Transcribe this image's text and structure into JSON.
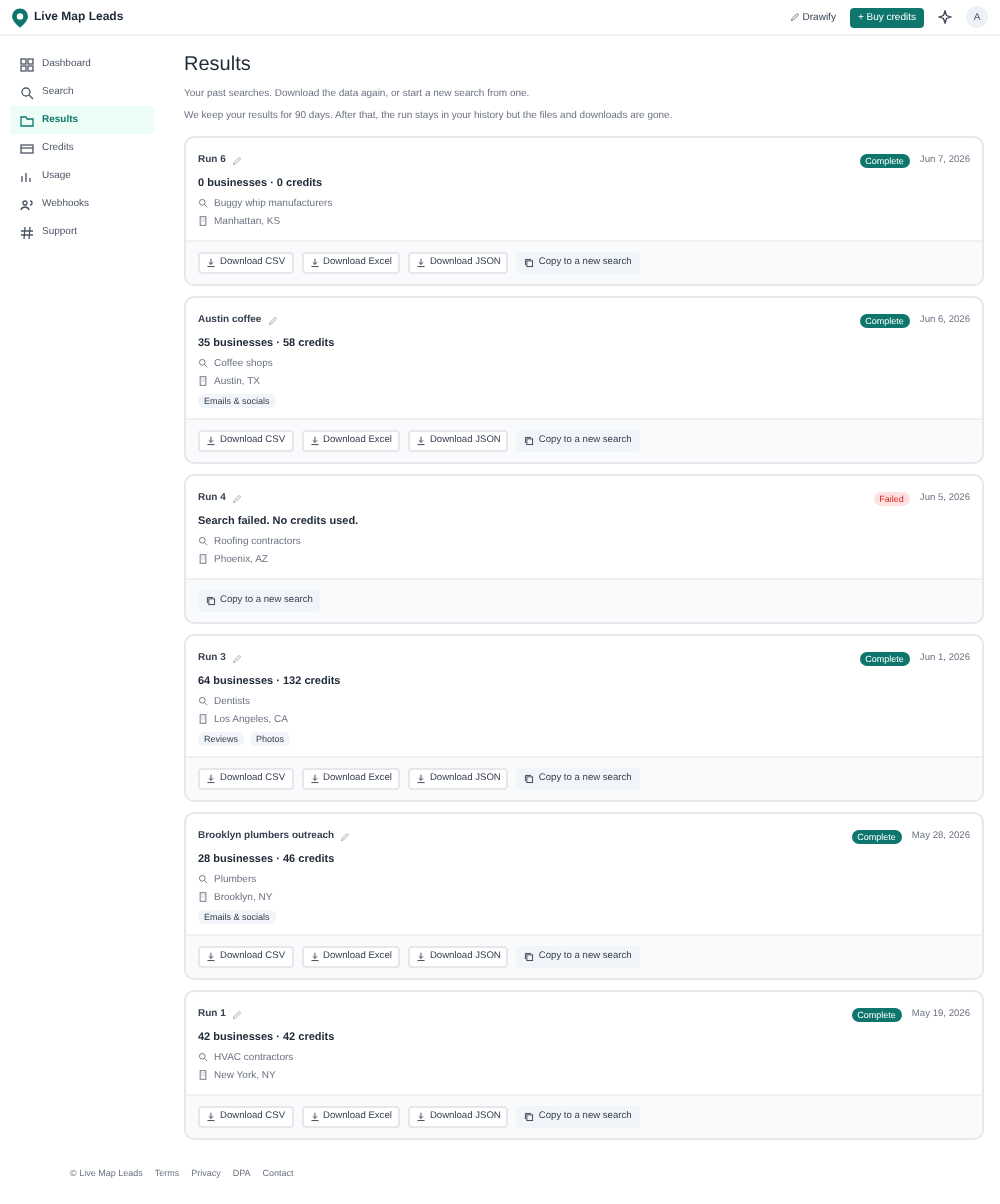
{
  "header": {
    "brand": "Live Map Leads",
    "link": "Drawify",
    "buy_button": "+ Buy credits",
    "avatar": "A"
  },
  "sidebar": {
    "items": [
      {
        "label": "Dashboard",
        "selected": false
      },
      {
        "label": "Search",
        "selected": false
      },
      {
        "label": "Results",
        "selected": true
      },
      {
        "label": "Credits",
        "selected": false
      },
      {
        "label": "Usage",
        "selected": false
      },
      {
        "label": "Webhooks",
        "selected": false
      },
      {
        "label": "Support",
        "selected": false
      }
    ]
  },
  "page": {
    "title": "Results",
    "subtitle": "Your past searches. Download the data again, or start a new search from one.",
    "note": "We keep your results for 90 days. After that, the run stays in your history but the files and downloads are gone."
  },
  "runs": [
    {
      "name": "Run 6",
      "kind": "complete",
      "status_label": "Complete",
      "date": "Jun 7, 2026",
      "summary": "0 businesses · 0 credits",
      "query": "Buggy whip manufacturers",
      "location": "Manhattan, KS",
      "actions": [
        {
          "kind": "download",
          "label": "Download CSV"
        },
        {
          "kind": "download",
          "label": "Download Excel"
        },
        {
          "kind": "download",
          "label": "Download JSON"
        },
        {
          "kind": "copy",
          "label": "Copy to a new search"
        }
      ]
    },
    {
      "name": "Austin coffee",
      "kind": "complete",
      "status_label": "Complete",
      "date": "Jun 6, 2026",
      "summary": "35 businesses · 58 credits",
      "query": "Coffee shops",
      "location": "Austin, TX",
      "tags": [
        "Emails & socials"
      ],
      "actions": [
        {
          "kind": "download",
          "label": "Download CSV"
        },
        {
          "kind": "download",
          "label": "Download Excel"
        },
        {
          "kind": "download",
          "label": "Download JSON"
        },
        {
          "kind": "copy",
          "label": "Copy to a new search"
        }
      ]
    },
    {
      "name": "Run 4",
      "kind": "failed",
      "status_label": "Failed",
      "date": "Jun 5, 2026",
      "summary": "Search failed. No credits used.",
      "query": "Roofing contractors",
      "location": "Phoenix, AZ",
      "actions": [
        {
          "kind": "copy",
          "label": "Copy to a new search"
        }
      ]
    },
    {
      "name": "Run 3",
      "kind": "complete",
      "status_label": "Complete",
      "date": "Jun 1, 2026",
      "summary": "64 businesses · 132 credits",
      "query": "Dentists",
      "location": "Los Angeles, CA",
      "tags": [
        "Reviews",
        "Photos"
      ],
      "actions": [
        {
          "kind": "download",
          "label": "Download CSV"
        },
        {
          "kind": "download",
          "label": "Download Excel"
        },
        {
          "kind": "download",
          "label": "Download JSON"
        },
        {
          "kind": "copy",
          "label": "Copy to a new search"
        }
      ]
    },
    {
      "name": "Brooklyn plumbers outreach",
      "kind": "complete",
      "status_label": "Complete",
      "date": "May 28, 2026",
      "summary": "28 businesses · 46 credits",
      "query": "Plumbers",
      "location": "Brooklyn, NY",
      "tags": [
        "Emails & socials"
      ],
      "actions": [
        {
          "kind": "download",
          "label": "Download CSV"
        },
        {
          "kind": "download",
          "label": "Download Excel"
        },
        {
          "kind": "download",
          "label": "Download JSON"
        },
        {
          "kind": "copy",
          "label": "Copy to a new search"
        }
      ]
    },
    {
      "name": "Run 1",
      "kind": "complete",
      "status_label": "Complete",
      "date": "May 19, 2026",
      "summary": "42 businesses · 42 credits",
      "query": "HVAC contractors",
      "location": "New York, NY",
      "actions": [
        {
          "kind": "download",
          "label": "Download CSV"
        },
        {
          "kind": "download",
          "label": "Download Excel"
        },
        {
          "kind": "download",
          "label": "Download JSON"
        },
        {
          "kind": "copy",
          "label": "Copy to a new search"
        }
      ]
    }
  ],
  "footer": {
    "copyright": "© Live Map Leads",
    "links": [
      "Terms",
      "Privacy",
      "DPA",
      "Contact"
    ]
  }
}
